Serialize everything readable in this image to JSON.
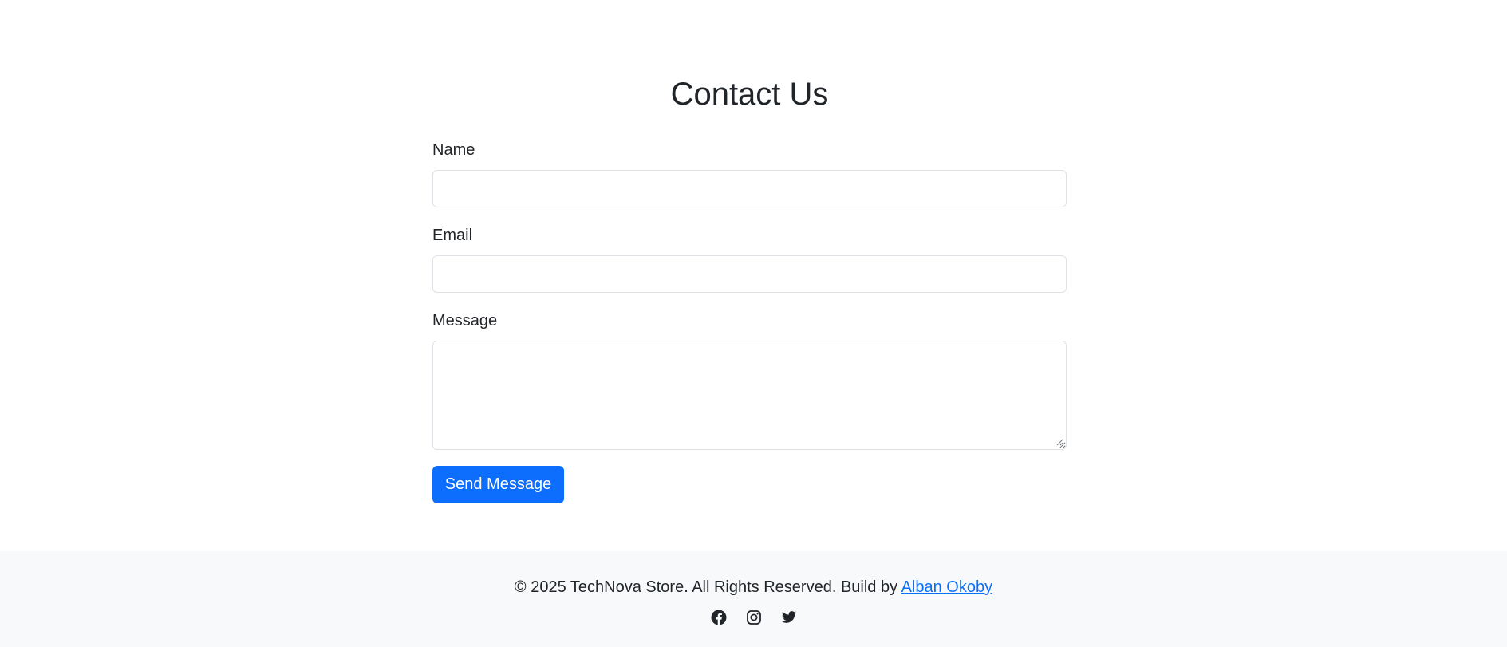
{
  "contact": {
    "title": "Contact Us",
    "name_label": "Name",
    "name_value": "",
    "email_label": "Email",
    "email_value": "",
    "message_label": "Message",
    "message_value": "",
    "submit_label": "Send Message"
  },
  "footer": {
    "copyright_text": "© 2025 TechNova Store. All Rights Reserved. Build by ",
    "author_link_text": "Alban Okoby",
    "social_icons": [
      "facebook-icon",
      "instagram-icon",
      "twitter-icon"
    ],
    "background_color": "#f8f9fa"
  },
  "colors": {
    "accent": "#0d6efd",
    "text": "#212529",
    "border": "#dee2e6"
  }
}
